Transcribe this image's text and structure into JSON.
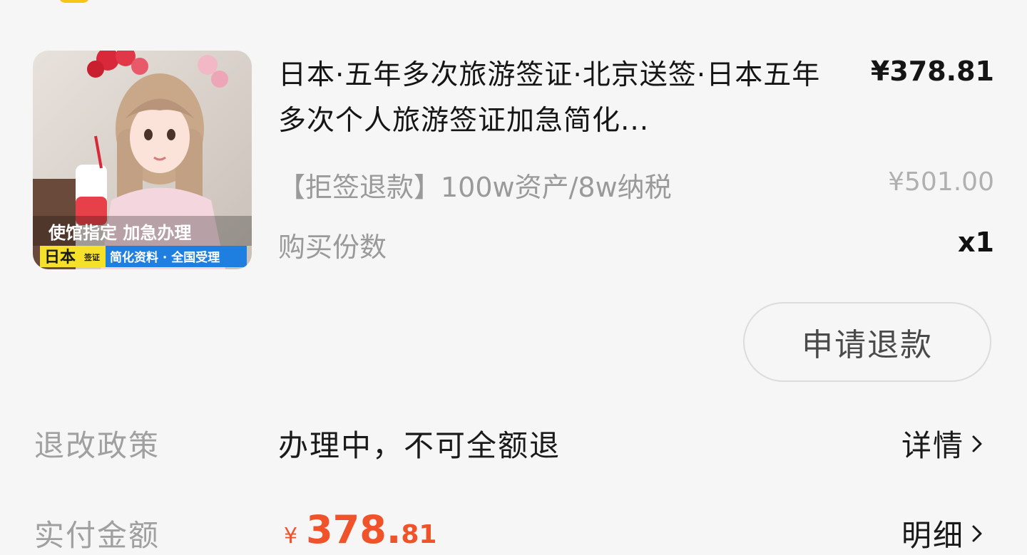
{
  "product": {
    "image_caption_top": "使馆指定  加急办理",
    "image_badge": "日本",
    "image_badge_small": "签证",
    "image_caption_bottom": "简化资料 · 全国受理",
    "title": "日本·五年多次旅游签证·北京送签·日本五年多次个人旅游签证加急简化...",
    "price": "¥378.81",
    "spec": "【拒签退款】100w资产/8w纳税",
    "original_price": "¥501.00",
    "quantity_label": "购买份数",
    "quantity": "x1"
  },
  "actions": {
    "refund_button": "申请退款"
  },
  "policy": {
    "label": "退改政策",
    "value": "办理中，不可全额退",
    "link": "详情"
  },
  "payment": {
    "label": "实付金额",
    "currency": "¥",
    "amount_integer": "378.",
    "amount_decimal": "81",
    "link": "明细"
  },
  "colors": {
    "accent_price": "#f0532a",
    "badge_yellow": "#f5e02a",
    "badge_blue": "#1f7fe0"
  }
}
